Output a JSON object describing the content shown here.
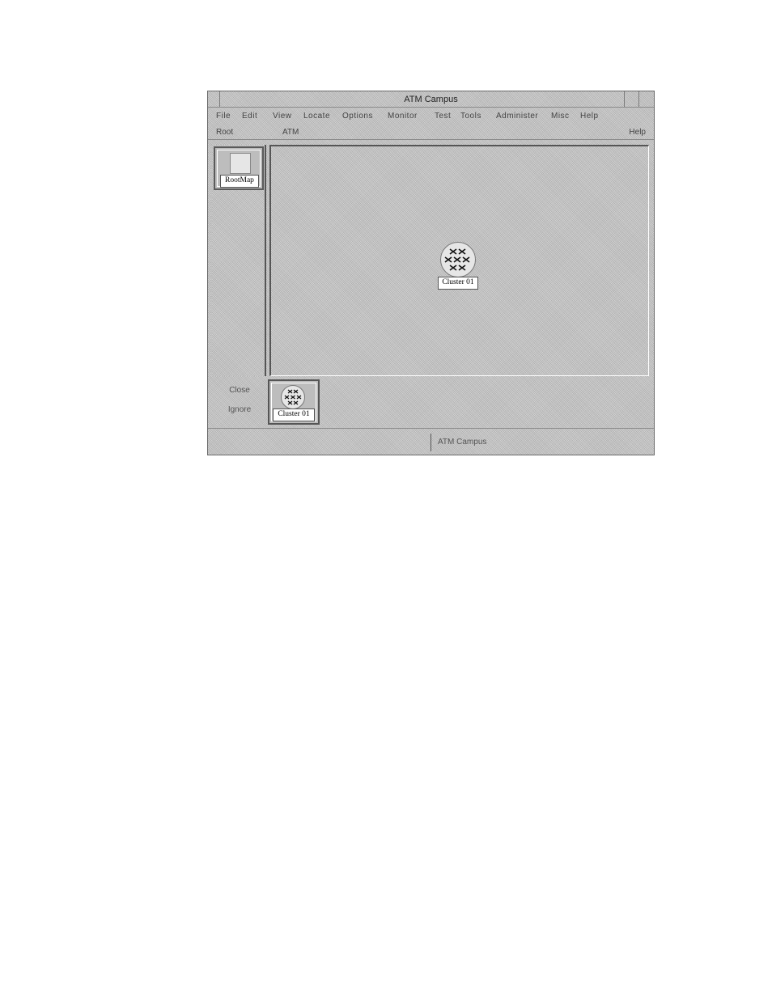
{
  "window": {
    "title": "ATM Campus"
  },
  "menubar": {
    "items": [
      "File",
      "Edit",
      "View",
      "Locate",
      "Options",
      "Monitor",
      "Test",
      "Tools",
      "Administer",
      "Misc",
      "Help"
    ]
  },
  "pathbar": {
    "crumbs": [
      "Root",
      "ATM"
    ],
    "help": "Help"
  },
  "tree": {
    "root_label": "RootMap"
  },
  "canvas": {
    "symbol_label": "Cluster 01"
  },
  "bottom_left": {
    "buttons": [
      "Close",
      "Ignore"
    ]
  },
  "tray": {
    "item_label": "Cluster 01"
  },
  "statusbar": {
    "left": "",
    "right": "ATM Campus"
  }
}
